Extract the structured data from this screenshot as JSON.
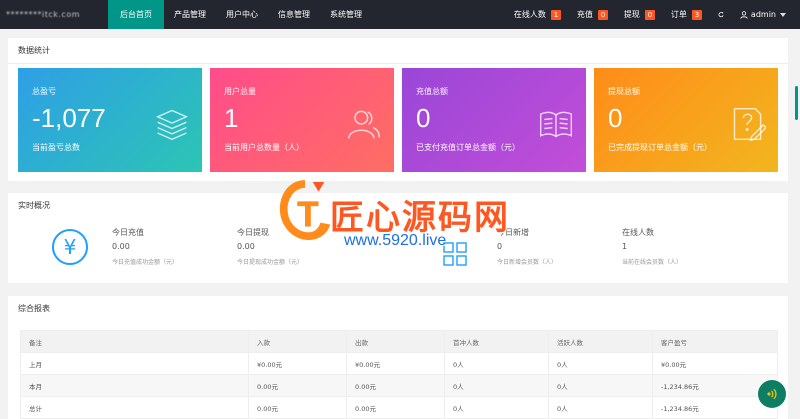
{
  "brand": "********itck.com",
  "nav": {
    "items": [
      {
        "label": "后台首页",
        "active": true
      },
      {
        "label": "产品管理",
        "active": false
      },
      {
        "label": "用户中心",
        "active": false
      },
      {
        "label": "信息管理",
        "active": false
      },
      {
        "label": "系统管理",
        "active": false
      }
    ],
    "right": [
      {
        "label": "在线人数",
        "badge": "1"
      },
      {
        "label": "充值",
        "badge": "0"
      },
      {
        "label": "提现",
        "badge": "0"
      },
      {
        "label": "订单",
        "badge": "3"
      }
    ],
    "refresh_icon": "refresh-icon",
    "user": "admin"
  },
  "stats": {
    "title": "数据统计",
    "cards": [
      {
        "title": "总盈亏",
        "value": "-1,077",
        "desc": "当前盈亏总数",
        "icon": "stack-icon"
      },
      {
        "title": "用户总量",
        "value": "1",
        "desc": "当前用户总数量（人）",
        "icon": "users-icon"
      },
      {
        "title": "充值总额",
        "value": "0",
        "desc": "已支付充值订单总金额（元）",
        "icon": "book-icon"
      },
      {
        "title": "提现总额",
        "value": "0",
        "desc": "已完成提现订单总金额（元）",
        "icon": "question-doc-icon"
      }
    ]
  },
  "realtime": {
    "title": "实时概况",
    "items": [
      {
        "label": "今日充值",
        "value": "0.00",
        "note": "今日充值成功金额（元）"
      },
      {
        "label": "今日提现",
        "value": "0.00",
        "note": "今日提现成功金额（元）"
      },
      {
        "label": "今日新增",
        "value": "0",
        "note": "今日新增会员数（人）"
      },
      {
        "label": "在线人数",
        "value": "1",
        "note": "当前在线会员数（人）"
      }
    ]
  },
  "report": {
    "title": "综合报表",
    "columns": [
      "备注",
      "入款",
      "出款",
      "首冲人数",
      "活跃人数",
      "客户盈亏"
    ],
    "rows": [
      [
        "上月",
        "¥0.00元",
        "¥0.00元",
        "0人",
        "0人",
        "¥0.00元"
      ],
      [
        "本月",
        "0.00元",
        "0.00元",
        "0人",
        "0人",
        "-1,234.86元"
      ],
      [
        "总计",
        "0.00元",
        "0.00元",
        "0人",
        "0人",
        "-1,234.86元"
      ]
    ]
  },
  "watermark": {
    "text": "匠心源码网",
    "url": "www.5920.live"
  },
  "colors": {
    "nav_bg": "#23262e",
    "nav_active": "#009688",
    "badge": "#ff5722",
    "card_blue": "#2e9fe6",
    "card_pink": "#ff4c8b",
    "card_purple": "#9a46d8",
    "card_orange": "#ff8c1a"
  }
}
